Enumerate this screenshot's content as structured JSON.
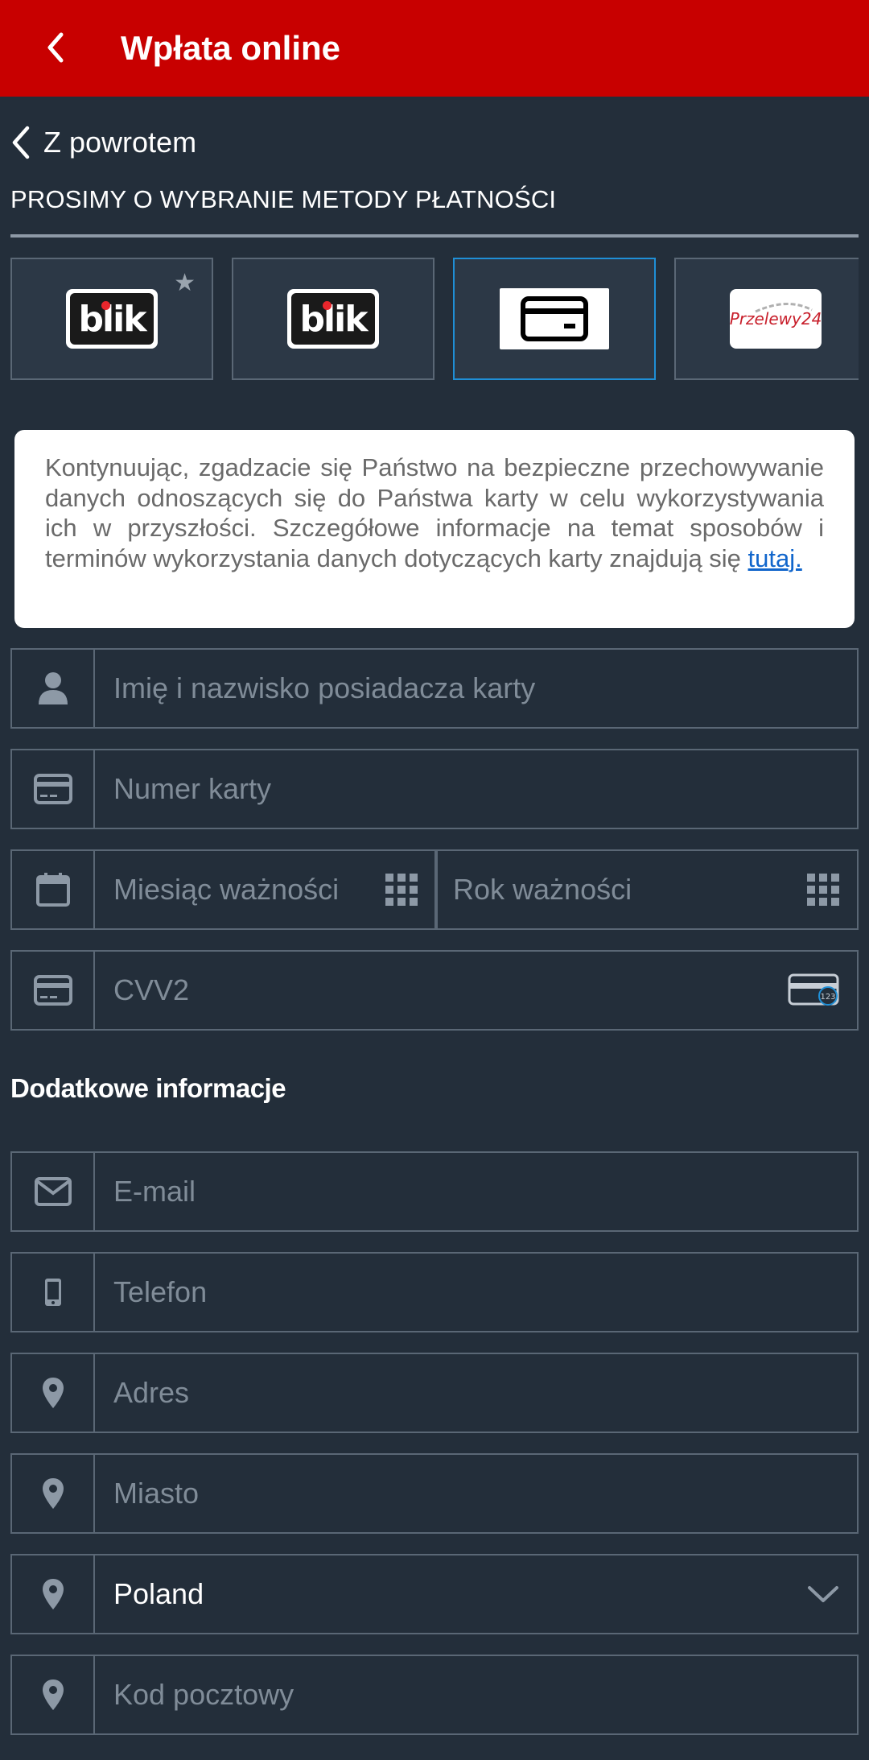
{
  "header": {
    "title": "Wpłata online"
  },
  "nav": {
    "return_label": "Z powrotem"
  },
  "section": {
    "title": "PROSIMY O WYBRANIE METODY PŁATNOŚCI"
  },
  "payment_methods": [
    {
      "name": "blik",
      "logo_text": "blik",
      "favorite": true,
      "selected": false
    },
    {
      "name": "blik",
      "logo_text": "blik",
      "favorite": false,
      "selected": false
    },
    {
      "name": "card",
      "icon": "credit-card-icon",
      "favorite": false,
      "selected": true
    },
    {
      "name": "przelewy24",
      "logo_text": "Przelewy24",
      "favorite": false,
      "selected": false
    }
  ],
  "notice": {
    "text": "Kontynuując, zgadzacie się Państwo na bezpieczne przechowywanie danych odnoszących się do Państwa karty w celu wykorzystywania ich w przyszłości. Szczegółowe informacje na temat sposobów i terminów wykorzystania danych dotyczących karty znajdują się ",
    "link_text": "tutaj."
  },
  "card_form": {
    "holder_placeholder": "Imię i nazwisko posiadacza karty",
    "number_placeholder": "Numer karty",
    "month_placeholder": "Miesiąc ważności",
    "year_placeholder": "Rok ważności",
    "cvv_placeholder": "CVV2",
    "cvv_hint_text": "123"
  },
  "additional": {
    "title": "Dodatkowe informacje",
    "email_placeholder": "E-mail",
    "phone_placeholder": "Telefon",
    "address_placeholder": "Adres",
    "city_placeholder": "Miasto",
    "country_value": "Poland",
    "postcode_placeholder": "Kod pocztowy"
  },
  "colors": {
    "header_bg": "#c80000",
    "page_bg": "#232e3a",
    "selected_border": "#1f8fd6",
    "link": "#1166cc"
  }
}
